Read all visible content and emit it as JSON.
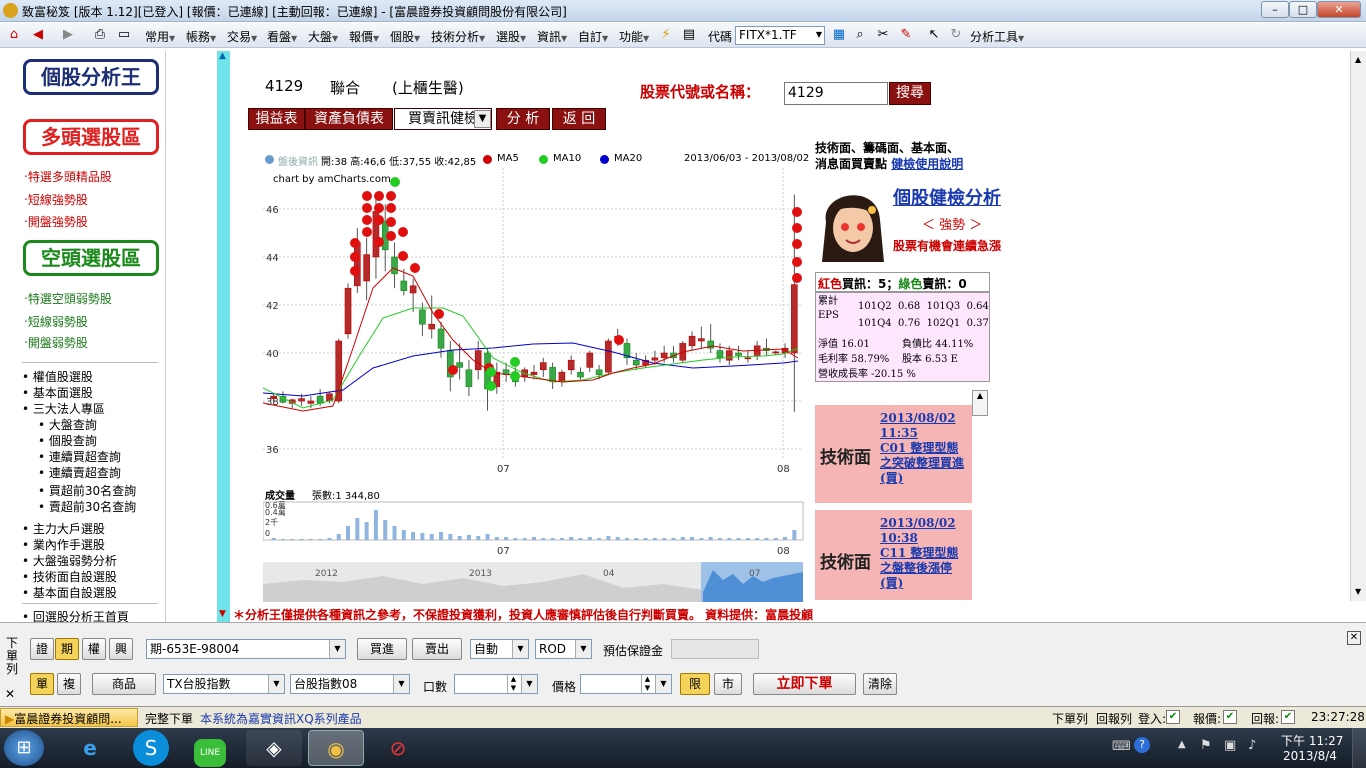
{
  "window": {
    "title": "致富秘笈 [版本 1.12][已登入] [報價：已連線] [主動回報：已連線] - [富晨證券投資顧問股份有限公司]"
  },
  "menu": {
    "items": [
      "常用",
      "帳務",
      "交易",
      "看盤",
      "大盤",
      "報價",
      "個股",
      "技術分析",
      "選股",
      "資訊",
      "自訂",
      "功能"
    ],
    "code_label": "代碼",
    "code_value": "FITX*1.TF",
    "analysis_tools": "分析工具"
  },
  "left": {
    "logo": "個股分析王",
    "bull_title": "多頭選股區",
    "bull_links": [
      "特選多頭精品股",
      "短線強勢股",
      "開盤強勢股"
    ],
    "bear_title": "空頭選股區",
    "bear_links": [
      "特選空頭弱勢股",
      "短線弱勢股",
      "開盤弱勢股"
    ],
    "menu1": [
      "權值股選股",
      "基本面選股",
      "三大法人專區"
    ],
    "sub1": [
      "大盤查詢",
      "個股查詢",
      "連續買超查詢",
      "連續賣超查詢",
      "買超前30名查詢",
      "賣超前30名查詢"
    ],
    "menu2": [
      "主力大戶選股",
      "業內作手選股",
      "大盤強弱勢分析",
      "技術面自設選股",
      "基本面自設選股",
      "回選股分析王首頁"
    ]
  },
  "stock": {
    "code": "4129",
    "name": "聯合",
    "market": "(上櫃生醫)",
    "search_label": "股票代號或名稱：",
    "search_value": "4129",
    "search_btn": "搜尋"
  },
  "tabs": [
    "損益表",
    "資產負債表",
    "買賣訊健檢",
    "分 析",
    "返 回"
  ],
  "chart": {
    "legend_close": "盤後資訊",
    "ohlc": "開:38 高:46,6 低:37,55 收:42,85",
    "ma": [
      {
        "name": "MA5",
        "color": "#d00000"
      },
      {
        "name": "MA10",
        "color": "#22cc22"
      },
      {
        "name": "MA20",
        "color": "#0000cc"
      }
    ],
    "date_range": "2013/06/03 - 2013/08/02",
    "credit": "chart by amCharts.com",
    "y_ticks": [
      "46",
      "44",
      "42",
      "40",
      "38",
      "36"
    ],
    "x_ticks": [
      "07",
      "08"
    ],
    "vol_label": "成交量",
    "vol_info": "張數:1 344,80",
    "vol_ticks": [
      "0.6萬",
      "0.4萬",
      "2千",
      "0"
    ],
    "nav_labels": [
      "2012",
      "2013",
      "04",
      "07"
    ]
  },
  "chart_data": {
    "type": "candlestick",
    "x": [
      "2013/06/03",
      "2013/08/02"
    ],
    "ylim": [
      36,
      47
    ],
    "last": {
      "open": 38,
      "high": 46.6,
      "low": 37.55,
      "close": 42.85
    },
    "series": [
      {
        "name": "MA5"
      },
      {
        "name": "MA10"
      },
      {
        "name": "MA20"
      }
    ],
    "volume": {
      "last": 1344.8
    }
  },
  "health": {
    "title": "技術面、籌碼面、基本面、",
    "title2": "消息面買賣點",
    "guide": "健檢使用說明",
    "analysis": "個股健檢分析",
    "strength": "＜ 強勢 ＞",
    "warn": "股票有機會連續急漲",
    "red": "紅色",
    "buy": "買訊：5；",
    "green": "綠色",
    "sell": "賣訊：0",
    "eps_label": "累計EPS",
    "eps1": "101Q2  0.68  101Q3  0.64",
    "eps2": "101Q4  0.76  102Q1  0.37",
    "nav": "淨值 16.01",
    "debt": "負債比 44.11%",
    "gm": "毛利率 58.79%",
    "cap": "股本 6.53 E",
    "rev": "營收成長率 -20.15 %"
  },
  "signals": [
    {
      "kind": "技術面",
      "date": "2013/08/02",
      "time": "11:35",
      "text": "C01 整理型態之突破整理買進(買)"
    },
    {
      "kind": "技術面",
      "date": "2013/08/02",
      "time": "10:38",
      "text": "C11 整理型態之盤整後漲停(買)"
    }
  ],
  "disclaimer": "＊分析王僅提供各種資訊之參考，不保證投資獲利，投資人應審慎評估後自行判斷買賣。  資料提供：富晨投顧",
  "order": {
    "side_label": "下單列",
    "types": [
      "證",
      "期",
      "權",
      "興"
    ],
    "account": "期-653E-98004",
    "buy": "買進",
    "sell": "賣出",
    "auto": "自動",
    "rod": "ROD",
    "margin": "預估保證金",
    "single": "單",
    "multi": "複",
    "product": "商品",
    "prod1": "TX台股指數",
    "prod2": "台股指數08",
    "qty": "口數",
    "price": "價格",
    "limit": "限",
    "market": "市",
    "submit": "立即下單",
    "clear": "清除"
  },
  "status": {
    "app": "富晨證券投資顧問...",
    "done": "完整下單",
    "note": "本系統為嘉實資訊XQ系列產品",
    "items": [
      "下單列",
      "回報列",
      "登入:",
      "報價:",
      "回報:"
    ],
    "time": "23:27:28"
  },
  "taskbar": {
    "time": "下午 11:27",
    "date": "2013/8/4"
  }
}
